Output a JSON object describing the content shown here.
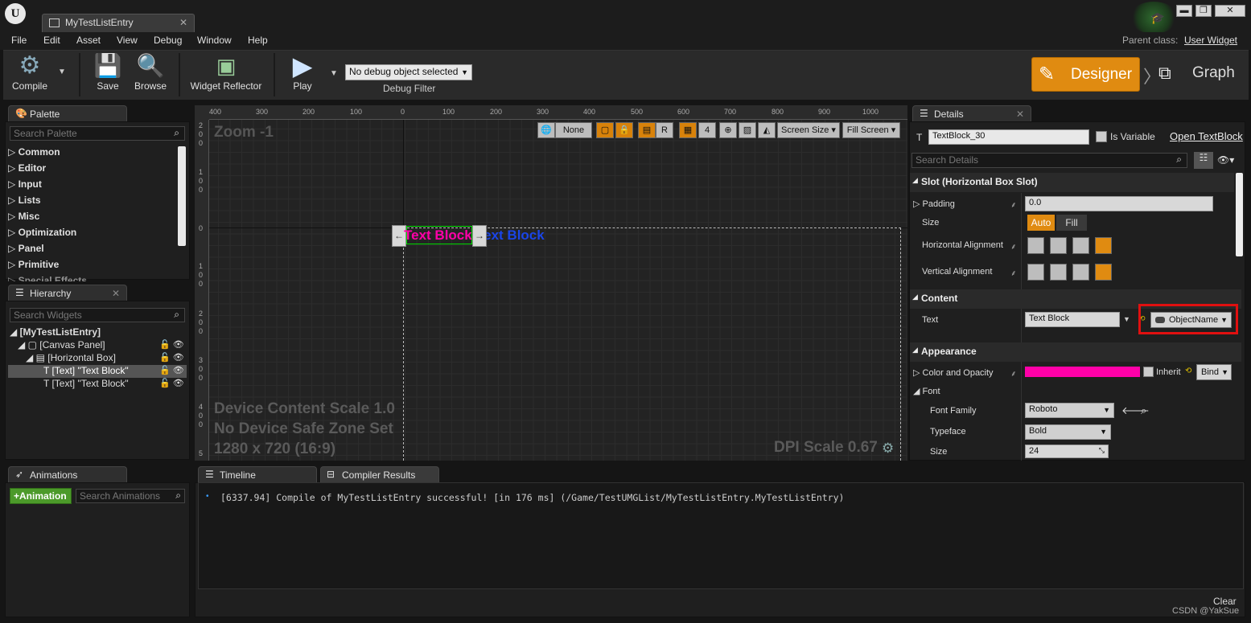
{
  "window": {
    "tab_title": "MyTestListEntry",
    "minimize": "▬",
    "maximize": "❐",
    "close": "✕"
  },
  "menu": [
    "File",
    "Edit",
    "Asset",
    "View",
    "Debug",
    "Window",
    "Help"
  ],
  "parent_class": {
    "label": "Parent class:",
    "value": "User Widget"
  },
  "toolbar": {
    "compile": "Compile",
    "save": "Save",
    "browse": "Browse",
    "widget_reflector": "Widget Reflector",
    "play": "Play",
    "debug_object": "No debug object selected",
    "debug_filter": "Debug Filter",
    "designer": "Designer",
    "graph": "Graph"
  },
  "palette": {
    "title": "Palette",
    "search_placeholder": "Search Palette",
    "items": [
      "Common",
      "Editor",
      "Input",
      "Lists",
      "Misc",
      "Optimization",
      "Panel",
      "Primitive",
      "Special Effects"
    ]
  },
  "hierarchy": {
    "title": "Hierarchy",
    "search_placeholder": "Search Widgets",
    "items": [
      {
        "label": "[MyTestListEntry]"
      },
      {
        "label": "[Canvas Panel]"
      },
      {
        "label": "[Horizontal Box]"
      },
      {
        "label": "[Text] \"Text Block\""
      },
      {
        "label": "[Text] \"Text Block\""
      }
    ]
  },
  "designer": {
    "zoom": "Zoom -1",
    "ruler_top": [
      "400",
      "300",
      "200",
      "100",
      "0",
      "100",
      "200",
      "300",
      "400",
      "500",
      "600",
      "700",
      "800",
      "900",
      "1000"
    ],
    "ruler_left": [
      "2",
      "0",
      "0",
      "1",
      "0",
      "0",
      "0",
      "1",
      "0",
      "0",
      "2",
      "0",
      "0",
      "3",
      "0",
      "0",
      "4",
      "0",
      "0",
      "5"
    ],
    "toolbar": {
      "none": "None",
      "r": "R",
      "grid_size": "4",
      "screen_size": "Screen Size",
      "fill_screen": "Fill Screen"
    },
    "text_block_1": "Text Block",
    "text_block_2": "Text Block",
    "info": [
      "Device Content Scale 1.0",
      "No Device Safe Zone Set",
      "1280 x 720 (16:9)"
    ],
    "dpi": "DPI Scale 0.67"
  },
  "details": {
    "title": "Details",
    "name": "TextBlock_30",
    "is_variable": "Is Variable",
    "open_link": "Open TextBlock",
    "search_placeholder": "Search Details",
    "slot_section": "Slot (Horizontal Box Slot)",
    "padding_label": "Padding",
    "padding_value": "0.0",
    "size_label": "Size",
    "size_auto": "Auto",
    "size_fill": "Fill",
    "h_align_label": "Horizontal Alignment",
    "v_align_label": "Vertical Alignment",
    "content_section": "Content",
    "text_label": "Text",
    "text_value": "Text Block",
    "bind_object": "ObjectName",
    "appearance_section": "Appearance",
    "color_label": "Color and Opacity",
    "color_value": "#ff00a8",
    "inherit": "Inherit",
    "bind": "Bind",
    "font_label": "Font",
    "font_family_label": "Font Family",
    "font_family_value": "Roboto",
    "typeface_label": "Typeface",
    "typeface_value": "Bold",
    "size2_label": "Size",
    "size2_value": "24"
  },
  "animations": {
    "title": "Animations",
    "add": "Animation",
    "search_placeholder": "Search Animations"
  },
  "bottom_tabs": {
    "timeline": "Timeline",
    "compiler": "Compiler Results"
  },
  "compiler": {
    "message": "[6337.94] Compile of MyTestListEntry successful! [in 176 ms] (/Game/TestUMGList/MyTestListEntry.MyTestListEntry)",
    "clear": "Clear"
  },
  "watermark": "CSDN @YakSue"
}
